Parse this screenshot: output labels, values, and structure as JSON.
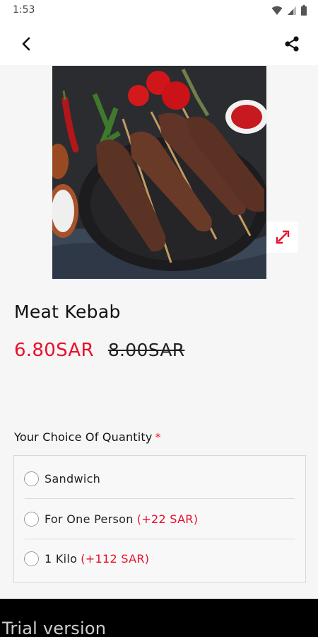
{
  "status_bar": {
    "time": "1:53",
    "icons": [
      "wifi-icon",
      "signal-icon",
      "battery-icon"
    ]
  },
  "app_bar": {
    "back_icon": "back-arrow-icon",
    "share_icon": "share-icon"
  },
  "product": {
    "image_icon": "kebab-photo",
    "expand_icon": "expand-icon",
    "title": "Meat Kebab",
    "price_now": "6.80SAR",
    "price_old": "8.00SAR"
  },
  "options_section": {
    "label": "Your Choice Of Quantity",
    "required_mark": "*",
    "options": [
      {
        "label": "Sandwich",
        "extra": ""
      },
      {
        "label": "For One Person",
        "extra": "(+22 SAR)"
      },
      {
        "label": "1 Kilo",
        "extra": "(+112 SAR)"
      }
    ]
  },
  "banner": {
    "text": "Trial version"
  },
  "colors": {
    "accent": "#e8102c",
    "banner": "#000000",
    "background": "#f6f6f6"
  }
}
